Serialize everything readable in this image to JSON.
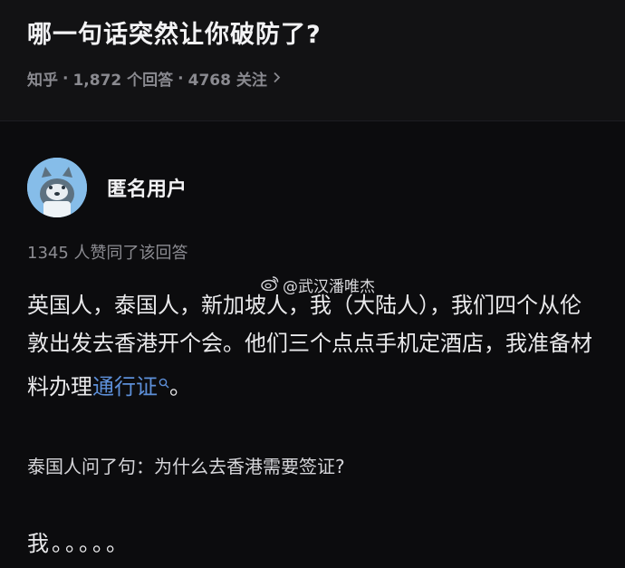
{
  "question": {
    "title": "哪一句话突然让你破防了?",
    "source": "知乎",
    "answer_count": "1,872 个回答",
    "follower_count": "4768 关注"
  },
  "answer": {
    "author": "匿名用户",
    "votes": "1345 人赞同了该回答",
    "paragraph_1_text": "英国人，泰国人，新加坡人，我（大陆人），我们四个从伦敦出发去香港开个会。他们三个点点手机定酒店，我准备材料办理",
    "paragraph_1_link": "通行证",
    "paragraph_1_end": "。",
    "paragraph_2": "泰国人问了句：为什么去香港需要签证?",
    "paragraph_3": "我。。。。。"
  },
  "watermark": {
    "text": "@武汉潘唯杰",
    "icon": "weibo-icon"
  },
  "colors": {
    "header_bg": "#121214",
    "body_bg": "#0c0c0e",
    "link": "#5d8fd8",
    "meta_gray": "#8a8a90"
  }
}
